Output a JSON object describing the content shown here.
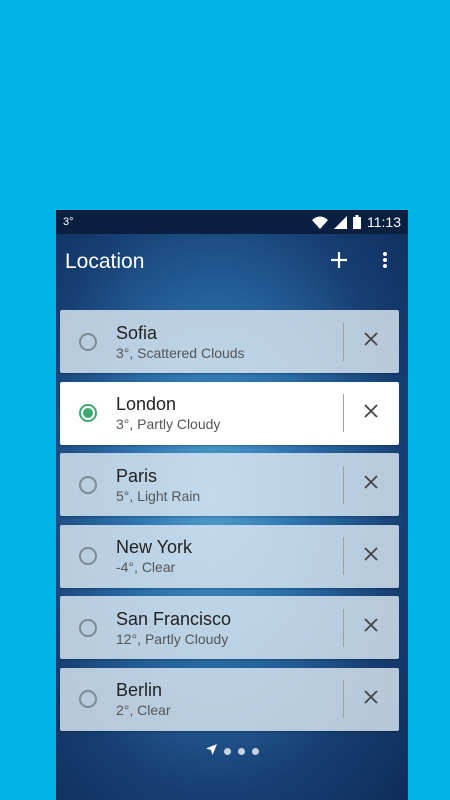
{
  "status_bar": {
    "temperature": "3°",
    "time": "11:13"
  },
  "appbar": {
    "title": "Location",
    "add_icon": "plus-icon",
    "menu_icon": "more-vert-icon"
  },
  "locations": [
    {
      "city": "Sofia",
      "desc": "3°, Scattered Clouds",
      "selected": false
    },
    {
      "city": "London",
      "desc": "3°, Partly Cloudy",
      "selected": true
    },
    {
      "city": "Paris",
      "desc": "5°, Light Rain",
      "selected": false
    },
    {
      "city": "New York",
      "desc": "-4°, Clear",
      "selected": false
    },
    {
      "city": "San Francisco",
      "desc": "12°, Partly Cloudy",
      "selected": false
    },
    {
      "city": "Berlin",
      "desc": "2°, Clear",
      "selected": false
    }
  ],
  "pager": {
    "pages": 3,
    "current_location_icon": "navigation-arrow-icon"
  },
  "colors": {
    "page_bg": "#00b3e6",
    "selected_radio": "#3cab6f",
    "card_bg": "#dce8f2"
  }
}
